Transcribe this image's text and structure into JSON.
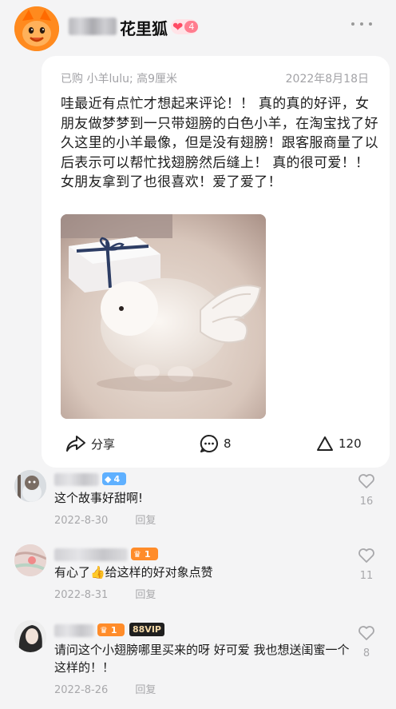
{
  "header": {
    "nickname": "花里狐",
    "level": "4"
  },
  "review": {
    "purchase_info": "已购 小羊lulu; 高9厘米",
    "date": "2022年8月18日",
    "text": "哇最近有点忙才想起来评论！！ 真的真的好评，女朋友做梦梦到一只带翅膀的白色小羊，在淘宝找了好久这里的小羊最像，但是没有翅膀！跟客服商量了以后表示可以帮忙找翅膀然后缝上！ 真的很可爱！！女朋友拿到了也很喜欢！爱了爱了！",
    "actions": {
      "share_label": "分享",
      "comment_count": "8",
      "like_count": "120"
    }
  },
  "comments": [
    {
      "level": "4",
      "text": "这个故事好甜啊!",
      "date": "2022-8-30",
      "reply_label": "回复",
      "like_count": "16"
    },
    {
      "level": "1",
      "text": "有心了👍给这样的好对象点赞",
      "date": "2022-8-31",
      "reply_label": "回复",
      "like_count": "11"
    },
    {
      "level": "1",
      "vip": "88VIP",
      "text": "请问这个小翅膀哪里买来的呀 好可爱 我也想送闺蜜一个这样的！！",
      "date": "2022-8-26",
      "reply_label": "回复",
      "like_count": "8"
    }
  ],
  "colors": {
    "accent_orange": "#ff8a1e",
    "heart_red": "#ff4a63",
    "muted_text": "#a2a2a6"
  }
}
